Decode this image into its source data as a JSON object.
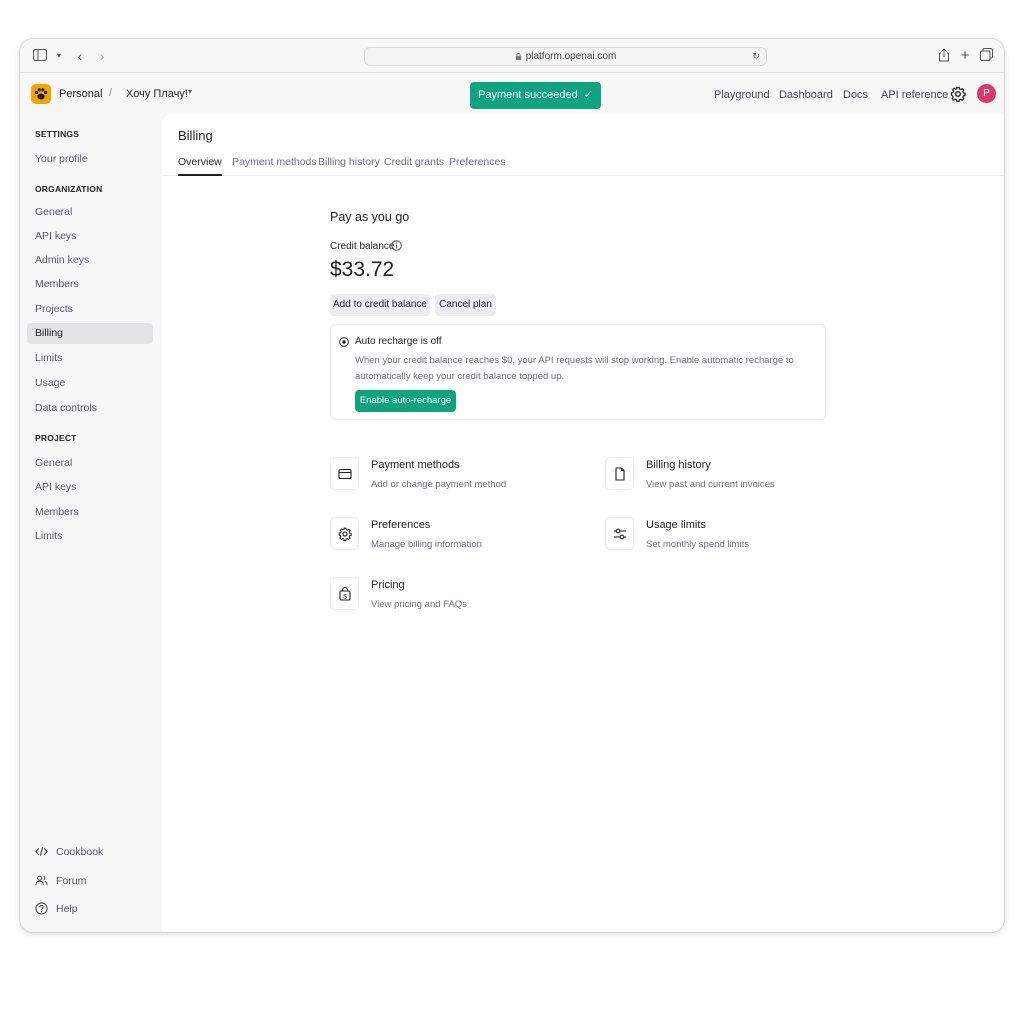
{
  "browser": {
    "url": "platform.openai.com"
  },
  "header": {
    "org_name": "Personal",
    "separator": "/",
    "project_name": "Хочу Плачу!",
    "toast": "Payment succeeded",
    "nav": [
      "Playground",
      "Dashboard",
      "Docs",
      "API reference"
    ],
    "avatar_letter": "P"
  },
  "sidebar": {
    "settings_heading": "SETTINGS",
    "settings_items": [
      "Your profile"
    ],
    "organization_heading": "ORGANIZATION",
    "organization_items": [
      "General",
      "API keys",
      "Admin keys",
      "Members",
      "Projects",
      "Billing",
      "Limits",
      "Usage",
      "Data controls"
    ],
    "project_heading": "PROJECT",
    "project_items": [
      "General",
      "API keys",
      "Members",
      "Limits"
    ],
    "footer": [
      "Cookbook",
      "Forum",
      "Help"
    ]
  },
  "main": {
    "title": "Billing",
    "tabs": [
      "Overview",
      "Payment methods",
      "Billing history",
      "Credit grants",
      "Preferences"
    ],
    "plan": "Pay as you go",
    "credit_label": "Credit balance",
    "balance": "$33.72",
    "add_button": "Add to credit balance",
    "cancel_button": "Cancel plan",
    "auto_recharge": {
      "title": "Auto recharge is off",
      "description": "When your credit balance reaches $0, your API requests will stop working. Enable automatic recharge to automatically keep your credit balance topped up.",
      "button": "Enable auto-recharge"
    },
    "cards": [
      {
        "title": "Payment methods",
        "desc": "Add or change payment method",
        "icon": "card-icon"
      },
      {
        "title": "Billing history",
        "desc": "View past and current invoices",
        "icon": "document-icon"
      },
      {
        "title": "Preferences",
        "desc": "Manage billing information",
        "icon": "gear-icon"
      },
      {
        "title": "Usage limits",
        "desc": "Set monthly spend limits",
        "icon": "sliders-icon"
      },
      {
        "title": "Pricing",
        "desc": "View pricing and FAQs",
        "icon": "price-tag-icon"
      }
    ]
  },
  "colors": {
    "accent": "#10a37f",
    "avatar": "#d9376e",
    "logo": "#f0a400"
  }
}
